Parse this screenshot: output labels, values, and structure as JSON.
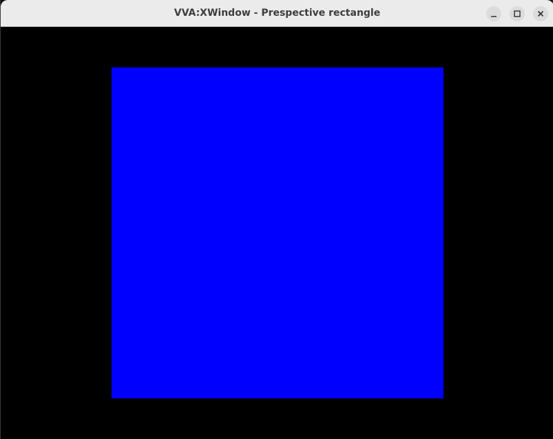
{
  "window": {
    "title": "VVA:XWindow - Prespective rectangle"
  },
  "controls": {
    "minimize_icon": "minimize-icon",
    "maximize_icon": "maximize-icon",
    "close_icon": "close-icon"
  },
  "canvas": {
    "background_color": "#000000",
    "shape": "rectangle",
    "shape_color": "#0000ff"
  }
}
